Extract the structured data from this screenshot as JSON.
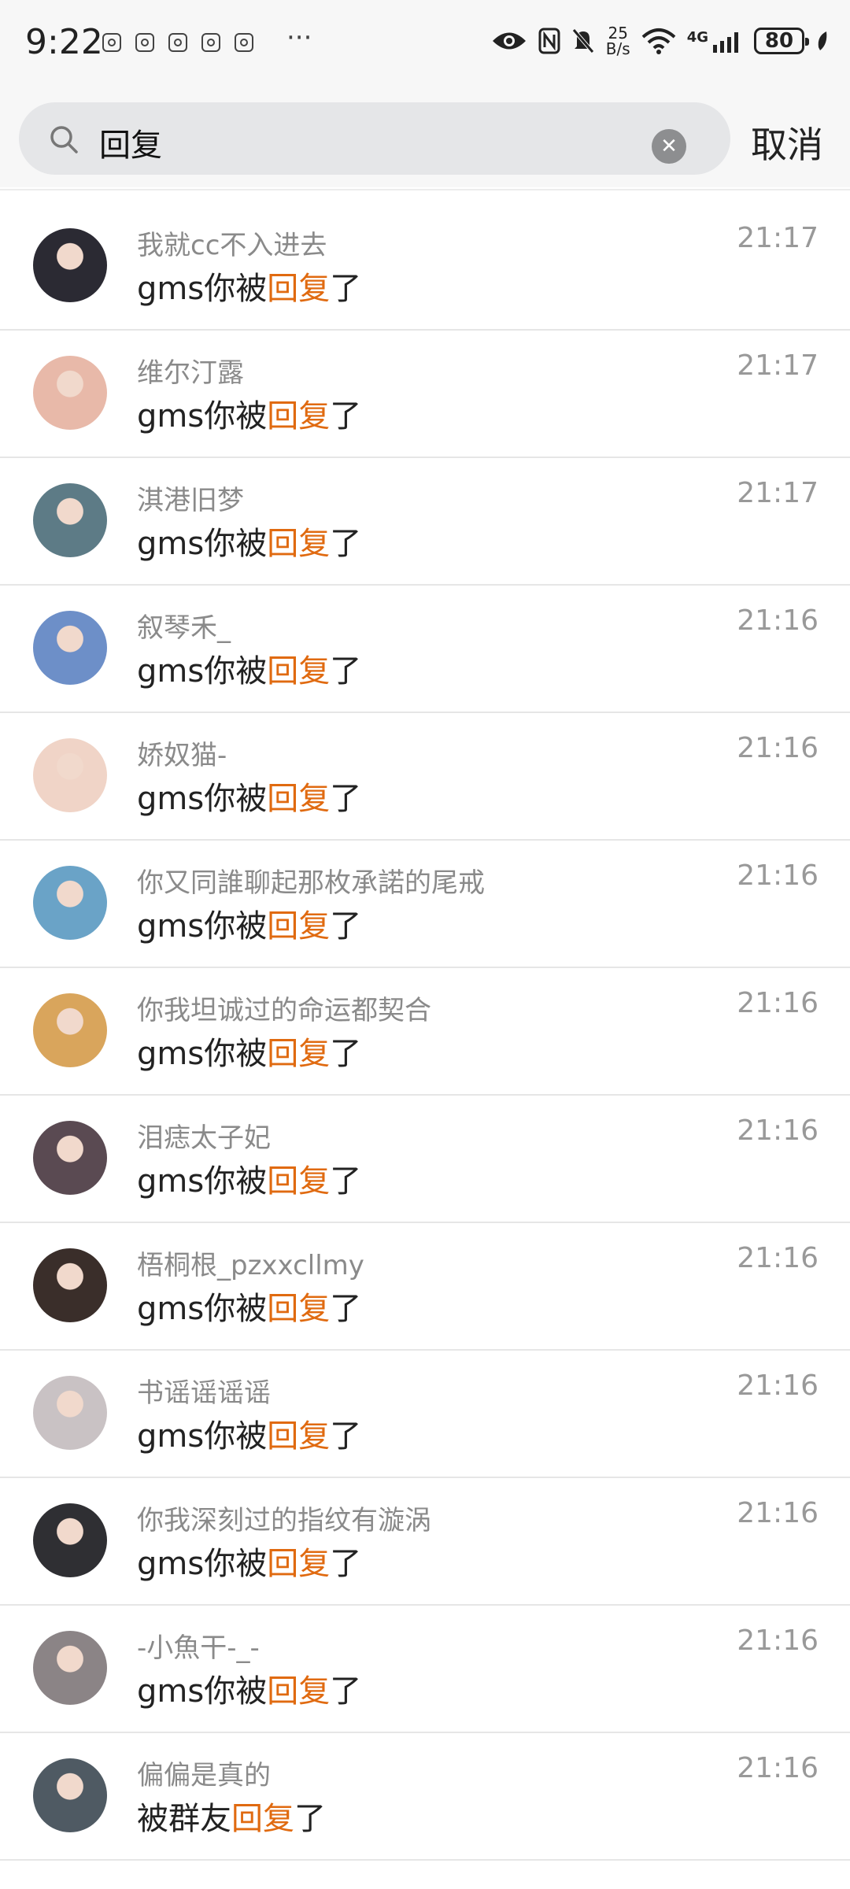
{
  "status": {
    "time": "9:22",
    "more": "···",
    "net_speed_top": "25",
    "net_speed_bottom": "B/s",
    "network": "4G",
    "battery": "80"
  },
  "search": {
    "query": "回复",
    "cancel_label": "取消"
  },
  "results": [
    {
      "name": "我就cc不入进去",
      "prefix": "gms你被",
      "keyword": "回复",
      "suffix": "了",
      "time": "21:17",
      "avatar_color": "#2b2a33"
    },
    {
      "name": "维尔汀露",
      "prefix": "gms你被",
      "keyword": "回复",
      "suffix": "了",
      "time": "21:17",
      "avatar_color": "#e8b9a9"
    },
    {
      "name": "淇港旧梦",
      "prefix": "gms你被",
      "keyword": "回复",
      "suffix": "了",
      "time": "21:17",
      "avatar_color": "#5d7b86"
    },
    {
      "name": "叙琴禾_",
      "prefix": "gms你被",
      "keyword": "回复",
      "suffix": "了",
      "time": "21:16",
      "avatar_color": "#6d8fc8"
    },
    {
      "name": "娇奴猫-",
      "prefix": "gms你被",
      "keyword": "回复",
      "suffix": "了",
      "time": "21:16",
      "avatar_color": "#f0d4c7"
    },
    {
      "name": "你又同誰聊起那枚承諾的尾戒",
      "prefix": "gms你被",
      "keyword": "回复",
      "suffix": "了",
      "time": "21:16",
      "avatar_color": "#6aa3c7"
    },
    {
      "name": "你我坦诚过的命运都契合",
      "prefix": "gms你被",
      "keyword": "回复",
      "suffix": "了",
      "time": "21:16",
      "avatar_color": "#d9a55c"
    },
    {
      "name": "泪痣太子妃",
      "prefix": "gms你被",
      "keyword": "回复",
      "suffix": "了",
      "time": "21:16",
      "avatar_color": "#5a4a52"
    },
    {
      "name": "梧桐根_pzxxcllmy",
      "prefix": "gms你被",
      "keyword": "回复",
      "suffix": "了",
      "time": "21:16",
      "avatar_color": "#3a2e2a"
    },
    {
      "name": "书谣谣谣谣",
      "prefix": "gms你被",
      "keyword": "回复",
      "suffix": "了",
      "time": "21:16",
      "avatar_color": "#c9c2c4"
    },
    {
      "name": "你我深刻过的指纹有漩涡",
      "prefix": "gms你被",
      "keyword": "回复",
      "suffix": "了",
      "time": "21:16",
      "avatar_color": "#2f2f33"
    },
    {
      "name": "-小魚干-_-",
      "prefix": "gms你被",
      "keyword": "回复",
      "suffix": "了",
      "time": "21:16",
      "avatar_color": "#8b8486"
    },
    {
      "name": "偏偏是真的",
      "prefix": "被群友",
      "keyword": "回复",
      "suffix": "了",
      "time": "21:16",
      "avatar_color": "#4f5a63"
    }
  ]
}
